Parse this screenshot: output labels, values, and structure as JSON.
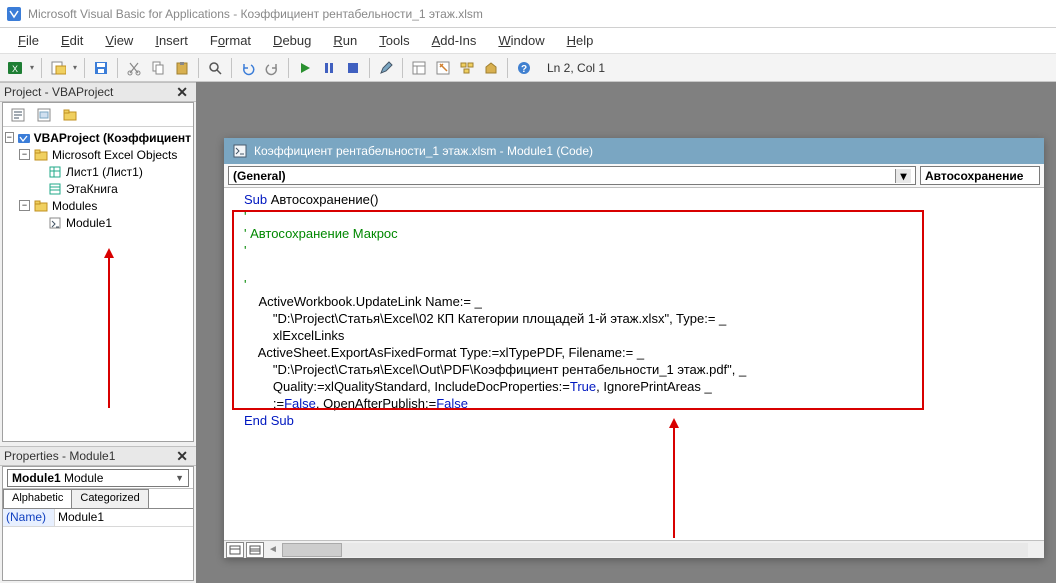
{
  "window": {
    "title": "Microsoft Visual Basic for Applications - Коэффициент рентабельности_1 этаж.xlsm"
  },
  "menu": {
    "file": "File",
    "edit": "Edit",
    "view": "View",
    "insert": "Insert",
    "format": "Format",
    "debug": "Debug",
    "run": "Run",
    "tools": "Tools",
    "addins": "Add-Ins",
    "window": "Window",
    "help": "Help"
  },
  "toolbar": {
    "cursor": "Ln 2, Col 1"
  },
  "project_pane": {
    "title": "Project - VBAProject",
    "root": "VBAProject (Коэффициент",
    "objects_folder": "Microsoft Excel Objects",
    "sheet1": "Лист1 (Лист1)",
    "thisworkbook": "ЭтаКнига",
    "modules_folder": "Modules",
    "module1": "Module1"
  },
  "properties_pane": {
    "title": "Properties - Module1",
    "object": "Module1 Module",
    "tab_alpha": "Alphabetic",
    "tab_cat": "Categorized",
    "name_key": "(Name)",
    "name_val": "Module1"
  },
  "mdi": {
    "title": "Коэффициент рентабельности_1 этаж.xlsm - Module1 (Code)",
    "dd_left": "(General)",
    "dd_right": "Автосохранение"
  },
  "code": {
    "l1a": "Sub",
    "l1b": " Автосохранение()",
    "l2": "'",
    "l3": "' Автосохранение Макрос",
    "l4": "'",
    "l5": "",
    "l6": "'",
    "l7": "    ActiveWorkbook.UpdateLink Name:= _",
    "l8": "        \"D:\\Project\\Статья\\Excel\\02 КП Категории площадей 1-й этаж.xlsx\", Type:= _",
    "l9": "        xlExcelLinks",
    "l10": "    ActiveSheet.ExportAsFixedFormat Type:=xlTypePDF, Filename:= _",
    "l11": "        \"D:\\Project\\Статья\\Excel\\Out\\PDF\\Коэффициент рентабельности_1 этаж.pdf\", _",
    "l12": "        Quality:=xlQualityStandard, IncludeDocProperties:=",
    "l12t": "True",
    "l12b": ", IgnorePrintAreas _",
    "l13a": "        :=",
    "l13f1": "False",
    "l13b": ", OpenAfterPublish:=",
    "l13f2": "False",
    "l14": "End Sub"
  }
}
